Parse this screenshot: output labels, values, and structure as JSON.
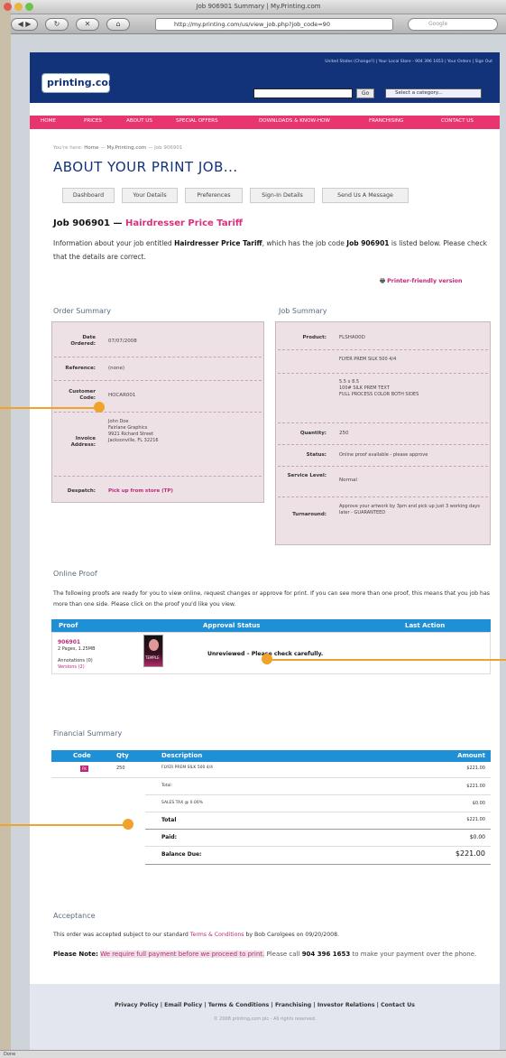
{
  "window": {
    "title": "Job 906901 Summary | My.Printing.com"
  },
  "browser": {
    "url": "http://my.printing.com/us/view_job.php?job_code=90",
    "search_placeholder": "Google"
  },
  "statusbar": {
    "text": "Done"
  },
  "header": {
    "logo": "printing.com",
    "top_links": "United States (Change?) | Your Local Store - 904 396 1653 | Your Orders | Sign Out",
    "go_label": "Go",
    "category_select": "Select a category..."
  },
  "nav": [
    "HOME",
    "PRICES",
    "ABOUT US",
    "SPECIAL OFFERS",
    "DOWNLOADS & KNOW-HOW",
    "FRANCHISING",
    "CONTACT US"
  ],
  "breadcrumb": {
    "prefix": "You're here:",
    "items": [
      "Home",
      "My.Printing.com",
      "Job 906901"
    ]
  },
  "page_title": "ABOUT YOUR PRINT JOB...",
  "tabs": [
    "Dashboard",
    "Your Details",
    "Preferences",
    "Sign-In Details",
    "Send Us A Message"
  ],
  "job": {
    "code": "Job 906901",
    "dash": "—",
    "title": "Hairdresser Price Tariff",
    "info_pre": "Information about your job entitled",
    "info_mid": ", which has the job code",
    "info_post": "is listed below. Please check that the details are correct.",
    "printer_friendly": "Printer-friendly version"
  },
  "order_summary": {
    "heading": "Order Summary",
    "date_label": "Date Ordered:",
    "date": "07/07/2008",
    "ref_label": "Reference:",
    "ref": "(none)",
    "cust_label": "Customer Code:",
    "cust": "HOCAR001",
    "addr_label": "Invoice Address:",
    "addr": [
      "John Doe",
      "Fairlane Graphics",
      "9921 Richard Street",
      "Jacksonville, FL 32216"
    ],
    "despatch_label": "Despatch:",
    "despatch": "Pick up from store (TP)"
  },
  "job_summary": {
    "heading": "Job Summary",
    "product_label": "Product:",
    "product": "FLSHA00D",
    "product_desc": "FLYER PREM SILK 500 4/4",
    "spec": [
      "5.5 x 8.5",
      "100# SILK PREM TEXT",
      "FULL PROCESS COLOR BOTH SIDES"
    ],
    "qty_label": "Quantity:",
    "qty": "250",
    "status_label": "Status:",
    "status": "Online proof available - please approve",
    "service_label": "Service Level:",
    "service": "Normal",
    "turn_label": "Turnaround:",
    "turn": "Approve your artwork by 3pm and pick up just 3 working days later - GUARANTEED"
  },
  "online_proof": {
    "heading": "Online Proof",
    "text": "The following proofs are ready for you to view online, request changes or approve for print. If you can see more than one proof, this means that you job has more than one side. Please click on the proof you'd like you view.",
    "cols": [
      "Proof",
      "Approval Status",
      "Last Action"
    ],
    "proof_id": "906901",
    "proof_meta": "2 Pages, 1.25MB",
    "annotations": "Annotations (0)",
    "versions": "Versions (2)",
    "thumb_text": "TEMPLE",
    "status": "Unreviewed – Please check carefully."
  },
  "financial": {
    "heading": "Financial Summary",
    "cols": [
      "Code",
      "Qty",
      "Description",
      "Amount"
    ],
    "line": {
      "code": "FK",
      "qty": "250",
      "desc": "FLYER PREM SILK 500 4/4",
      "amount": "$221.00"
    },
    "rows": [
      {
        "label": "Total:",
        "amount": "$221.00"
      },
      {
        "label": "SALES TAX @ 0.00%",
        "amount": "$0.00"
      },
      {
        "label": "Total",
        "amount": "$221.00"
      },
      {
        "label": "Paid:",
        "amount": "$0.00"
      },
      {
        "label": "Balance Due:",
        "amount": "$221.00"
      }
    ]
  },
  "acceptance": {
    "heading": "Acceptance",
    "text_pre": "This order was accepted subject to our standard",
    "terms": "Terms & Conditions",
    "text_post": "by Bob Carolgees on 09/20/2008.",
    "note_label": "Please Note:",
    "note_highlight": "We require full payment before we proceed to print.",
    "note_mid": "Please call",
    "phone": "904 396 1653",
    "note_post": "to make your payment over the phone."
  },
  "footer": {
    "links": [
      "Privacy Policy",
      "Email Policy",
      "Terms & Conditions",
      "Franchising",
      "Investor Relations",
      "Contact Us"
    ],
    "copyright": "© 2008 printing.com plc - All rights reserved."
  }
}
